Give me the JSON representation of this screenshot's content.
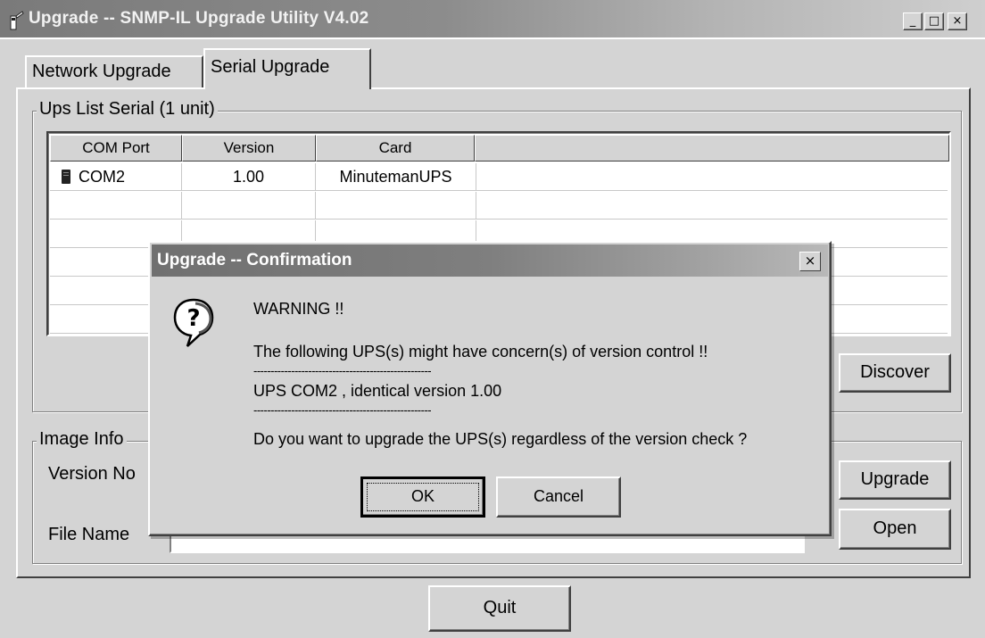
{
  "window": {
    "title": "Upgrade --  SNMP-IL Upgrade Utility V4.02",
    "controls": {
      "minimize": "_",
      "maximize": "□",
      "close": "×"
    }
  },
  "tabs": [
    {
      "label": "Network Upgrade",
      "active": false
    },
    {
      "label": "Serial Upgrade",
      "active": true
    }
  ],
  "ups_list": {
    "group_label": "Ups List Serial (1 unit)",
    "columns": [
      "COM Port",
      "Version",
      "Card",
      ""
    ],
    "rows": [
      {
        "port": "COM2",
        "version": "1.00",
        "card": "MinutemanUPS",
        "icon": "ups-icon"
      }
    ],
    "discover_button": "Discover"
  },
  "image_info": {
    "group_label": "Image Info",
    "version_label": "Version No",
    "file_name_label": "File Name",
    "upgrade_button": "Upgrade",
    "open_button": "Open"
  },
  "quit_button": "Quit",
  "dialog": {
    "title": "Upgrade -- Confirmation",
    "icon": "question-icon",
    "warning": "WARNING !!",
    "line1": "The following UPS(s) might have concern(s) of version control !!",
    "separator": "----------------------------------------------------",
    "line2": "UPS COM2 , identical version 1.00",
    "line3": "Do you want to upgrade the UPS(s) regardless of the version check ?",
    "ok_button": "OK",
    "cancel_button": "Cancel",
    "close_glyph": "×"
  }
}
